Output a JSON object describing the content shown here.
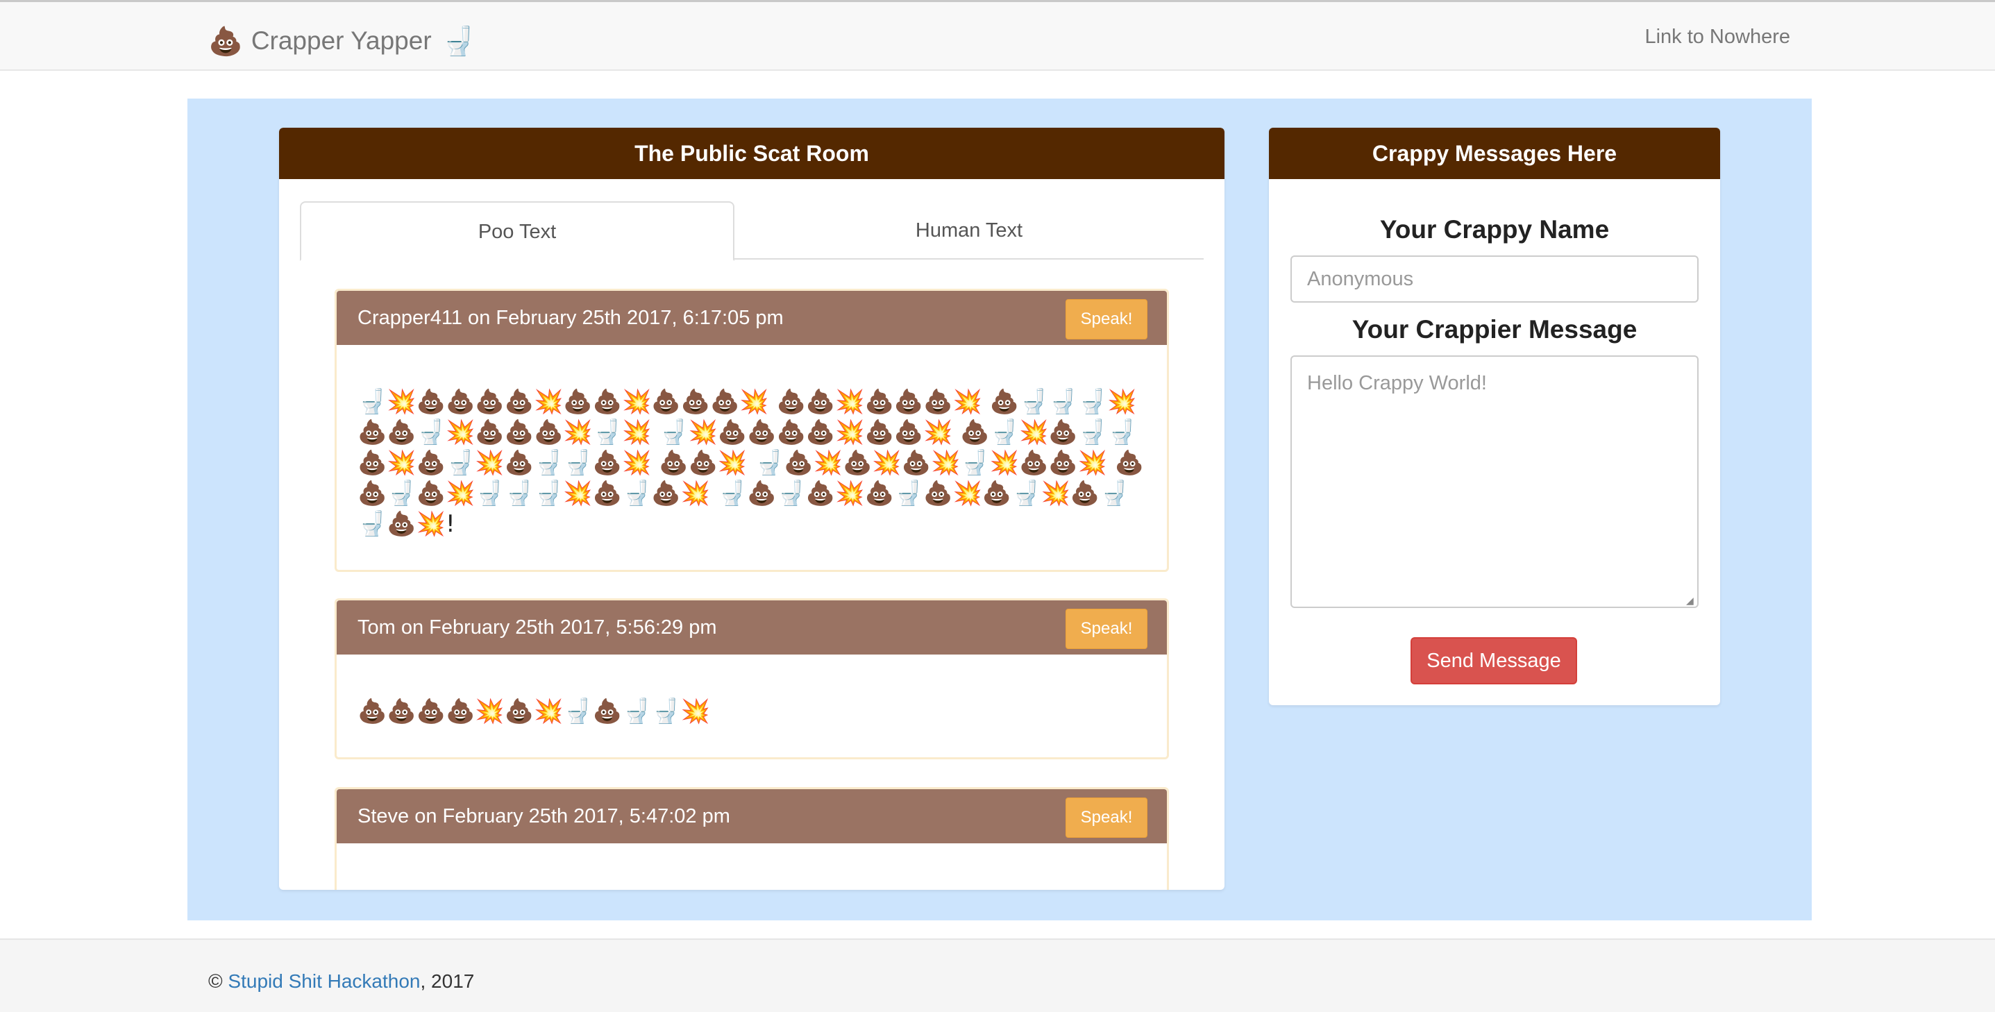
{
  "navbar": {
    "brand_left_emoji": "💩",
    "brand_title": "Crapper Yapper",
    "brand_right_emoji": "🚽",
    "link": "Link to Nowhere"
  },
  "chat_panel": {
    "title": "The Public Scat Room",
    "tabs": [
      {
        "label": "Poo Text",
        "active": true
      },
      {
        "label": "Human Text",
        "active": false
      }
    ],
    "messages": [
      {
        "header": "Crapper411 on February 25th 2017, 6:17:05 pm",
        "speak_label": "Speak!",
        "body": "🚽💥💩💩💩💩💥💩💩💥💩💩💩💥 💩💩💥💩💩💩💥 💩🚽🚽🚽💥💩💩🚽💥💩💩💩💥🚽💥 🚽💥💩💩💩💩💥💩💩💥 💩🚽💥💩🚽🚽💩💥💩🚽💥💩🚽🚽💩💥 💩💩💥 🚽💩💥💩💥💩💥🚽💥💩💩💥 💩💩🚽💩💥🚽🚽🚽💥💩🚽💩💥 🚽💩🚽💩💥💩🚽💩💥💩🚽💥💩🚽🚽💩💥!"
      },
      {
        "header": "Tom on February 25th 2017, 5:56:29 pm",
        "speak_label": "Speak!",
        "body": "💩💩💩💩💥💩💥🚽💩🚽🚽💥"
      },
      {
        "header": "Steve on February 25th 2017, 5:47:02 pm",
        "speak_label": "Speak!",
        "body": ""
      }
    ]
  },
  "form_panel": {
    "title": "Crappy Messages Here",
    "name_label": "Your Crappy Name",
    "name_placeholder": "Anonymous",
    "message_label": "Your Crappier Message",
    "message_placeholder": "Hello Crappy World!",
    "send_label": "Send Message"
  },
  "footer": {
    "copyright_symbol": "©",
    "link_text": "Stupid Shit Hackathon",
    "year_text": ", 2017"
  }
}
